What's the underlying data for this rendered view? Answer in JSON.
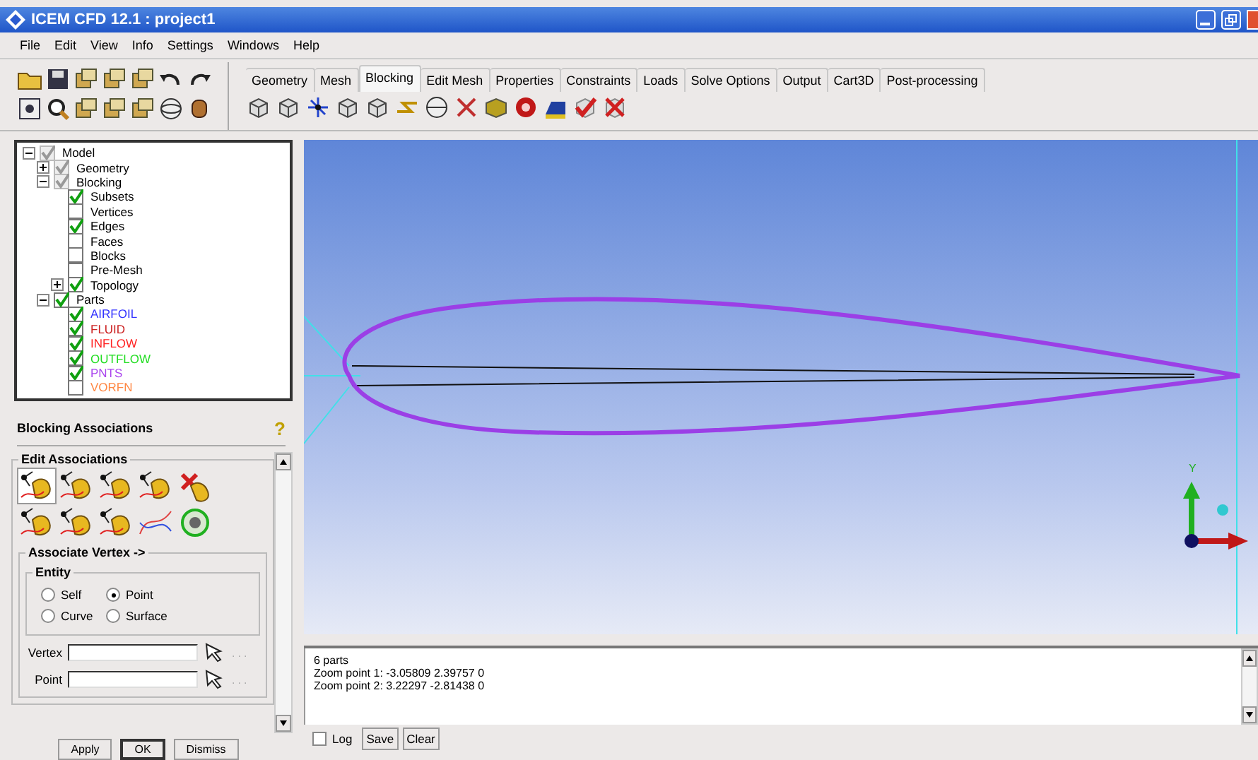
{
  "window": {
    "title": "ICEM CFD 12.1 : project1"
  },
  "menu": [
    "File",
    "Edit",
    "View",
    "Info",
    "Settings",
    "Windows",
    "Help"
  ],
  "tabs": [
    {
      "label": "Geometry",
      "selected": false
    },
    {
      "label": "Mesh",
      "selected": false
    },
    {
      "label": "Blocking",
      "selected": true
    },
    {
      "label": "Edit Mesh",
      "selected": false
    },
    {
      "label": "Properties",
      "selected": false
    },
    {
      "label": "Constraints",
      "selected": false
    },
    {
      "label": "Loads",
      "selected": false
    },
    {
      "label": "Solve Options",
      "selected": false
    },
    {
      "label": "Output",
      "selected": false
    },
    {
      "label": "Cart3D",
      "selected": false
    },
    {
      "label": "Post-processing",
      "selected": false
    }
  ],
  "tree": [
    {
      "label": "Model",
      "checked": true,
      "greyed": true,
      "expanded": true,
      "children": [
        {
          "label": "Geometry",
          "checked": true,
          "greyed": true,
          "expanded": false
        },
        {
          "label": "Blocking",
          "checked": true,
          "greyed": true,
          "expanded": true,
          "children": [
            {
              "label": "Subsets",
              "checked": true,
              "greyed": false
            },
            {
              "label": "Vertices",
              "checked": false,
              "greyed": false
            },
            {
              "label": "Edges",
              "checked": true,
              "greyed": false
            },
            {
              "label": "Faces",
              "checked": false,
              "greyed": false
            },
            {
              "label": "Blocks",
              "checked": false,
              "greyed": false
            },
            {
              "label": "Pre-Mesh",
              "checked": false,
              "greyed": false
            },
            {
              "label": "Topology",
              "checked": true,
              "greyed": false,
              "expanded": false
            }
          ]
        },
        {
          "label": "Parts",
          "checked": true,
          "greyed": false,
          "expanded": true,
          "children": [
            {
              "label": "AIRFOIL",
              "checked": true,
              "greyed": false,
              "color": "#3333ff"
            },
            {
              "label": "FLUID",
              "checked": true,
              "greyed": false,
              "color": "#cc2222"
            },
            {
              "label": "INFLOW",
              "checked": true,
              "greyed": false,
              "color": "#ff2222"
            },
            {
              "label": "OUTFLOW",
              "checked": true,
              "greyed": false,
              "color": "#22dd22"
            },
            {
              "label": "PNTS",
              "checked": true,
              "greyed": false,
              "color": "#aa44ee"
            },
            {
              "label": "VORFN",
              "checked": false,
              "greyed": false,
              "color": "#ff8844"
            }
          ]
        }
      ]
    }
  ],
  "panel": {
    "title": "Blocking Associations",
    "help": "?",
    "group": "Edit Associations",
    "subgroup": "Associate Vertex ->",
    "entity_title": "Entity",
    "radios": [
      {
        "label": "Self",
        "selected": false
      },
      {
        "label": "Point",
        "selected": true
      },
      {
        "label": "Curve",
        "selected": false
      },
      {
        "label": "Surface",
        "selected": false
      }
    ],
    "fields": [
      {
        "label": "Vertex",
        "browse": "..."
      },
      {
        "label": "Point",
        "browse": "..."
      }
    ],
    "buttons": [
      "Apply",
      "OK",
      "Dismiss"
    ]
  },
  "viewport": {
    "axis_label": "Y"
  },
  "log": {
    "lines": [
      "6 parts",
      "Zoom point 1: -3.05809 2.39757 0",
      "Zoom point 2: 3.22297 -2.81438 0"
    ],
    "log_checkbox": {
      "label": "Log",
      "checked": false
    },
    "buttons": [
      "Save",
      "Clear"
    ]
  }
}
